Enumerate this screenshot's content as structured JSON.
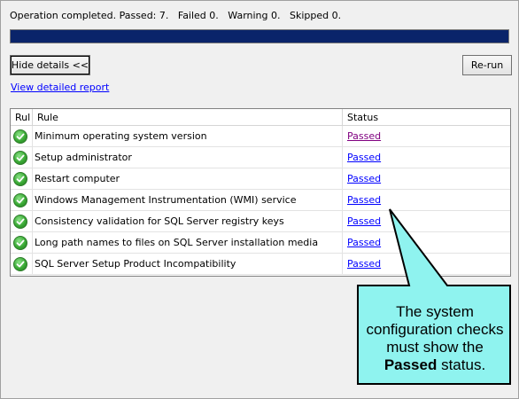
{
  "status_line": "Operation completed. Passed: 7.   Failed 0.   Warning 0.   Skipped 0.",
  "progress_percent": 100,
  "buttons": {
    "hide_details": "Hide details <<",
    "rerun": "Re-run"
  },
  "report_link": "View detailed report",
  "table": {
    "headers": {
      "rul": "Rul",
      "rule": "Rule",
      "status": "Status"
    },
    "rows": [
      {
        "rule": "Minimum operating system version",
        "status": "Passed"
      },
      {
        "rule": "Setup administrator",
        "status": "Passed"
      },
      {
        "rule": "Restart computer",
        "status": "Passed"
      },
      {
        "rule": "Windows Management Instrumentation (WMI) service",
        "status": "Passed"
      },
      {
        "rule": "Consistency validation for SQL Server registry keys",
        "status": "Passed"
      },
      {
        "rule": "Long path names to files on SQL Server installation media",
        "status": "Passed"
      },
      {
        "rule": "SQL Server Setup Product Incompatibility",
        "status": "Passed"
      }
    ]
  },
  "callout": {
    "text_before": "The system configuration checks must show the ",
    "text_bold": "Passed",
    "text_after": " status.",
    "fill_color": "#8ff3ef"
  },
  "colors": {
    "progress": "#0a246a",
    "link": "#0000ff",
    "visited_link": "#800080",
    "check": "#3aa935"
  },
  "icons": {
    "status_icon": "green-check-icon"
  }
}
